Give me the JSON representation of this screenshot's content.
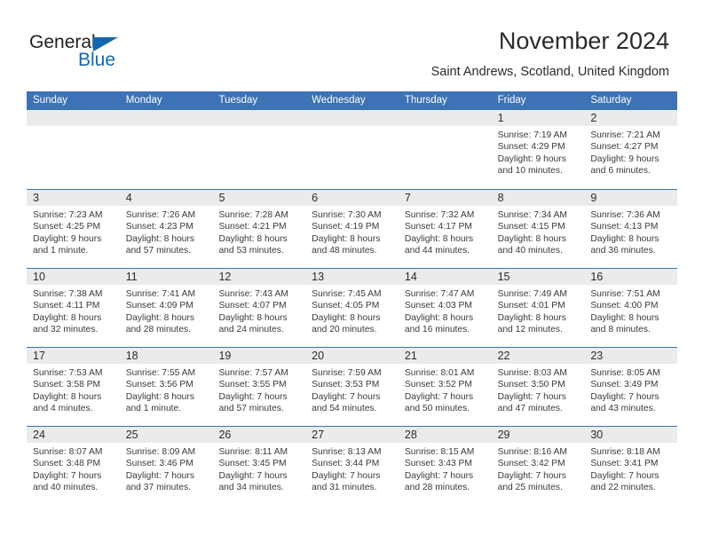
{
  "brand": {
    "name_part1": "General",
    "name_part2": "Blue",
    "logo_icon": "triangle-icon",
    "color_dark": "#231f20",
    "color_blue": "#1267b5"
  },
  "header": {
    "title": "November 2024",
    "subtitle": "Saint Andrews, Scotland, United Kingdom"
  },
  "theme": {
    "header_bar": "#3d72b4",
    "day_band": "#ebebeb",
    "row_rule": "#3d72b4",
    "text": "#3a3a3a"
  },
  "weekdays": [
    "Sunday",
    "Monday",
    "Tuesday",
    "Wednesday",
    "Thursday",
    "Friday",
    "Saturday"
  ],
  "weeks": [
    [
      {
        "day": "",
        "sunrise": "",
        "sunset": "",
        "daylight": ""
      },
      {
        "day": "",
        "sunrise": "",
        "sunset": "",
        "daylight": ""
      },
      {
        "day": "",
        "sunrise": "",
        "sunset": "",
        "daylight": ""
      },
      {
        "day": "",
        "sunrise": "",
        "sunset": "",
        "daylight": ""
      },
      {
        "day": "",
        "sunrise": "",
        "sunset": "",
        "daylight": ""
      },
      {
        "day": "1",
        "sunrise": "Sunrise: 7:19 AM",
        "sunset": "Sunset: 4:29 PM",
        "daylight": "Daylight: 9 hours and 10 minutes."
      },
      {
        "day": "2",
        "sunrise": "Sunrise: 7:21 AM",
        "sunset": "Sunset: 4:27 PM",
        "daylight": "Daylight: 9 hours and 6 minutes."
      }
    ],
    [
      {
        "day": "3",
        "sunrise": "Sunrise: 7:23 AM",
        "sunset": "Sunset: 4:25 PM",
        "daylight": "Daylight: 9 hours and 1 minute."
      },
      {
        "day": "4",
        "sunrise": "Sunrise: 7:26 AM",
        "sunset": "Sunset: 4:23 PM",
        "daylight": "Daylight: 8 hours and 57 minutes."
      },
      {
        "day": "5",
        "sunrise": "Sunrise: 7:28 AM",
        "sunset": "Sunset: 4:21 PM",
        "daylight": "Daylight: 8 hours and 53 minutes."
      },
      {
        "day": "6",
        "sunrise": "Sunrise: 7:30 AM",
        "sunset": "Sunset: 4:19 PM",
        "daylight": "Daylight: 8 hours and 48 minutes."
      },
      {
        "day": "7",
        "sunrise": "Sunrise: 7:32 AM",
        "sunset": "Sunset: 4:17 PM",
        "daylight": "Daylight: 8 hours and 44 minutes."
      },
      {
        "day": "8",
        "sunrise": "Sunrise: 7:34 AM",
        "sunset": "Sunset: 4:15 PM",
        "daylight": "Daylight: 8 hours and 40 minutes."
      },
      {
        "day": "9",
        "sunrise": "Sunrise: 7:36 AM",
        "sunset": "Sunset: 4:13 PM",
        "daylight": "Daylight: 8 hours and 36 minutes."
      }
    ],
    [
      {
        "day": "10",
        "sunrise": "Sunrise: 7:38 AM",
        "sunset": "Sunset: 4:11 PM",
        "daylight": "Daylight: 8 hours and 32 minutes."
      },
      {
        "day": "11",
        "sunrise": "Sunrise: 7:41 AM",
        "sunset": "Sunset: 4:09 PM",
        "daylight": "Daylight: 8 hours and 28 minutes."
      },
      {
        "day": "12",
        "sunrise": "Sunrise: 7:43 AM",
        "sunset": "Sunset: 4:07 PM",
        "daylight": "Daylight: 8 hours and 24 minutes."
      },
      {
        "day": "13",
        "sunrise": "Sunrise: 7:45 AM",
        "sunset": "Sunset: 4:05 PM",
        "daylight": "Daylight: 8 hours and 20 minutes."
      },
      {
        "day": "14",
        "sunrise": "Sunrise: 7:47 AM",
        "sunset": "Sunset: 4:03 PM",
        "daylight": "Daylight: 8 hours and 16 minutes."
      },
      {
        "day": "15",
        "sunrise": "Sunrise: 7:49 AM",
        "sunset": "Sunset: 4:01 PM",
        "daylight": "Daylight: 8 hours and 12 minutes."
      },
      {
        "day": "16",
        "sunrise": "Sunrise: 7:51 AM",
        "sunset": "Sunset: 4:00 PM",
        "daylight": "Daylight: 8 hours and 8 minutes."
      }
    ],
    [
      {
        "day": "17",
        "sunrise": "Sunrise: 7:53 AM",
        "sunset": "Sunset: 3:58 PM",
        "daylight": "Daylight: 8 hours and 4 minutes."
      },
      {
        "day": "18",
        "sunrise": "Sunrise: 7:55 AM",
        "sunset": "Sunset: 3:56 PM",
        "daylight": "Daylight: 8 hours and 1 minute."
      },
      {
        "day": "19",
        "sunrise": "Sunrise: 7:57 AM",
        "sunset": "Sunset: 3:55 PM",
        "daylight": "Daylight: 7 hours and 57 minutes."
      },
      {
        "day": "20",
        "sunrise": "Sunrise: 7:59 AM",
        "sunset": "Sunset: 3:53 PM",
        "daylight": "Daylight: 7 hours and 54 minutes."
      },
      {
        "day": "21",
        "sunrise": "Sunrise: 8:01 AM",
        "sunset": "Sunset: 3:52 PM",
        "daylight": "Daylight: 7 hours and 50 minutes."
      },
      {
        "day": "22",
        "sunrise": "Sunrise: 8:03 AM",
        "sunset": "Sunset: 3:50 PM",
        "daylight": "Daylight: 7 hours and 47 minutes."
      },
      {
        "day": "23",
        "sunrise": "Sunrise: 8:05 AM",
        "sunset": "Sunset: 3:49 PM",
        "daylight": "Daylight: 7 hours and 43 minutes."
      }
    ],
    [
      {
        "day": "24",
        "sunrise": "Sunrise: 8:07 AM",
        "sunset": "Sunset: 3:48 PM",
        "daylight": "Daylight: 7 hours and 40 minutes."
      },
      {
        "day": "25",
        "sunrise": "Sunrise: 8:09 AM",
        "sunset": "Sunset: 3:46 PM",
        "daylight": "Daylight: 7 hours and 37 minutes."
      },
      {
        "day": "26",
        "sunrise": "Sunrise: 8:11 AM",
        "sunset": "Sunset: 3:45 PM",
        "daylight": "Daylight: 7 hours and 34 minutes."
      },
      {
        "day": "27",
        "sunrise": "Sunrise: 8:13 AM",
        "sunset": "Sunset: 3:44 PM",
        "daylight": "Daylight: 7 hours and 31 minutes."
      },
      {
        "day": "28",
        "sunrise": "Sunrise: 8:15 AM",
        "sunset": "Sunset: 3:43 PM",
        "daylight": "Daylight: 7 hours and 28 minutes."
      },
      {
        "day": "29",
        "sunrise": "Sunrise: 8:16 AM",
        "sunset": "Sunset: 3:42 PM",
        "daylight": "Daylight: 7 hours and 25 minutes."
      },
      {
        "day": "30",
        "sunrise": "Sunrise: 8:18 AM",
        "sunset": "Sunset: 3:41 PM",
        "daylight": "Daylight: 7 hours and 22 minutes."
      }
    ]
  ]
}
